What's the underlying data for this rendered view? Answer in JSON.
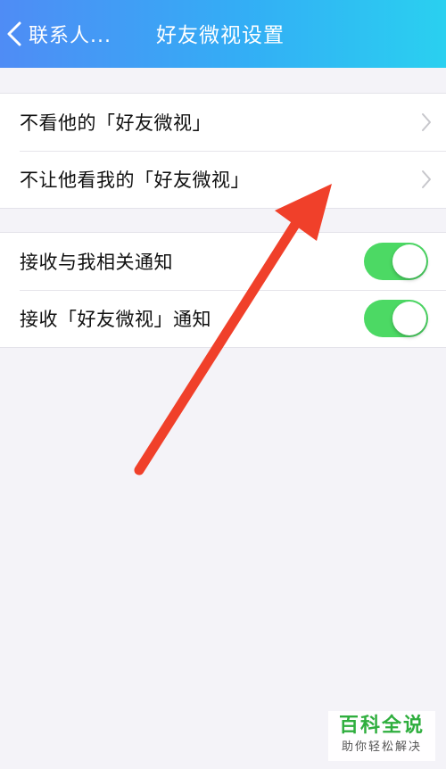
{
  "navbar": {
    "back_label": "联系人...",
    "title": "好友微视设置"
  },
  "group1": {
    "items": [
      {
        "label": "不看他的「好友微视」"
      },
      {
        "label": "不让他看我的「好友微视」"
      }
    ]
  },
  "group2": {
    "items": [
      {
        "label": "接收与我相关通知",
        "enabled": true
      },
      {
        "label": "接收「好友微视」通知",
        "enabled": true
      }
    ]
  },
  "watermark": {
    "title": "百科全说",
    "subtitle": "助你轻松解决"
  },
  "colors": {
    "navbar_start": "#4f8cf5",
    "navbar_end": "#2ad0f0",
    "toggle_on": "#4cd964",
    "arrow": "#f0402a",
    "watermark_green": "#2fae3e"
  },
  "icons": {
    "back": "chevron-left-icon",
    "disclosure": "chevron-right-icon"
  }
}
